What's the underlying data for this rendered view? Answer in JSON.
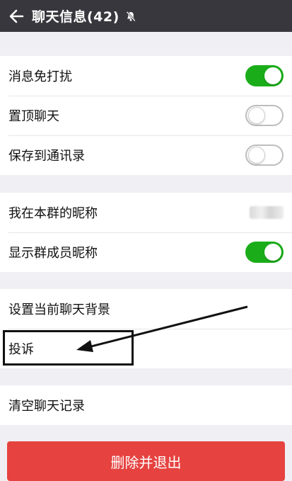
{
  "header": {
    "title": "聊天信息(42)",
    "back_icon": "arrow-left-icon",
    "mute_icon": "bell-off-icon"
  },
  "section1": {
    "items": [
      {
        "label": "消息免打扰",
        "toggle": true
      },
      {
        "label": "置顶聊天",
        "toggle": false
      },
      {
        "label": "保存到通讯录",
        "toggle": false
      }
    ]
  },
  "section2": {
    "items": [
      {
        "label": "我在本群的昵称"
      },
      {
        "label": "显示群成员昵称",
        "toggle": true
      }
    ]
  },
  "section3": {
    "items": [
      {
        "label": "设置当前聊天背景"
      },
      {
        "label": "投诉"
      }
    ]
  },
  "section4": {
    "items": [
      {
        "label": "清空聊天记录"
      }
    ]
  },
  "delete_button": {
    "label": "删除并退出"
  },
  "colors": {
    "header_bg": "#37373d",
    "toggle_on": "#1aad19",
    "delete_bg": "#e64340",
    "page_bg": "#efeff4"
  }
}
